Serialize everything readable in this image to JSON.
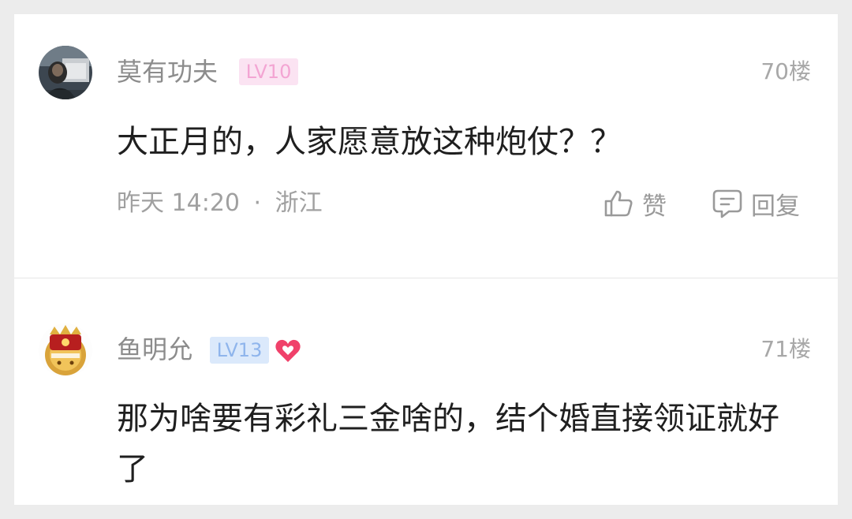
{
  "comments": [
    {
      "username": "莫有功夫",
      "level": "LV10",
      "floor": "70楼",
      "text": "大正月的，人家愿意放这种炮仗？？",
      "time": "昨天 14:20",
      "separator": "·",
      "location": "浙江",
      "like_label": "赞",
      "reply_label": "回复",
      "level_color": "#f3a5d3"
    },
    {
      "username": "鱼明允",
      "level": "LV13",
      "floor": "71楼",
      "text": "那为啥要有彩礼三金啥的，结个婚直接领证就好了",
      "badge_icon": "heart-badge-icon",
      "level_color": "#8fb5ec"
    }
  ],
  "colors": {
    "background": "#ececec",
    "card": "#ffffff",
    "heart": "#f0416a"
  }
}
